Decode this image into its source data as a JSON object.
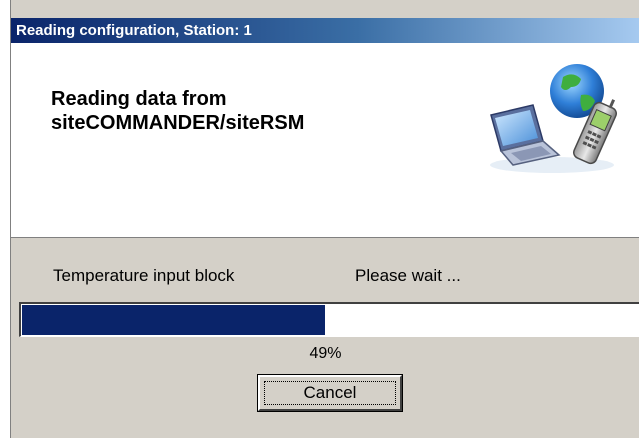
{
  "dialog": {
    "title": "Reading configuration, Station: 1",
    "heading_line1": "Reading data from",
    "heading_line2": "siteCOMMANDER/siteRSM",
    "illustration": "laptop-phone-globe-icon"
  },
  "status": {
    "block_name": "Temperature input block",
    "message": "Please wait ..."
  },
  "progress": {
    "percent_label": "49%",
    "value": 0.49,
    "fill_color": "#0a246a"
  },
  "buttons": {
    "cancel_label": "Cancel"
  },
  "colors": {
    "titlebar_start": "#0a246a",
    "titlebar_end": "#a6caf0",
    "dialog_face": "#d4d0c8"
  }
}
